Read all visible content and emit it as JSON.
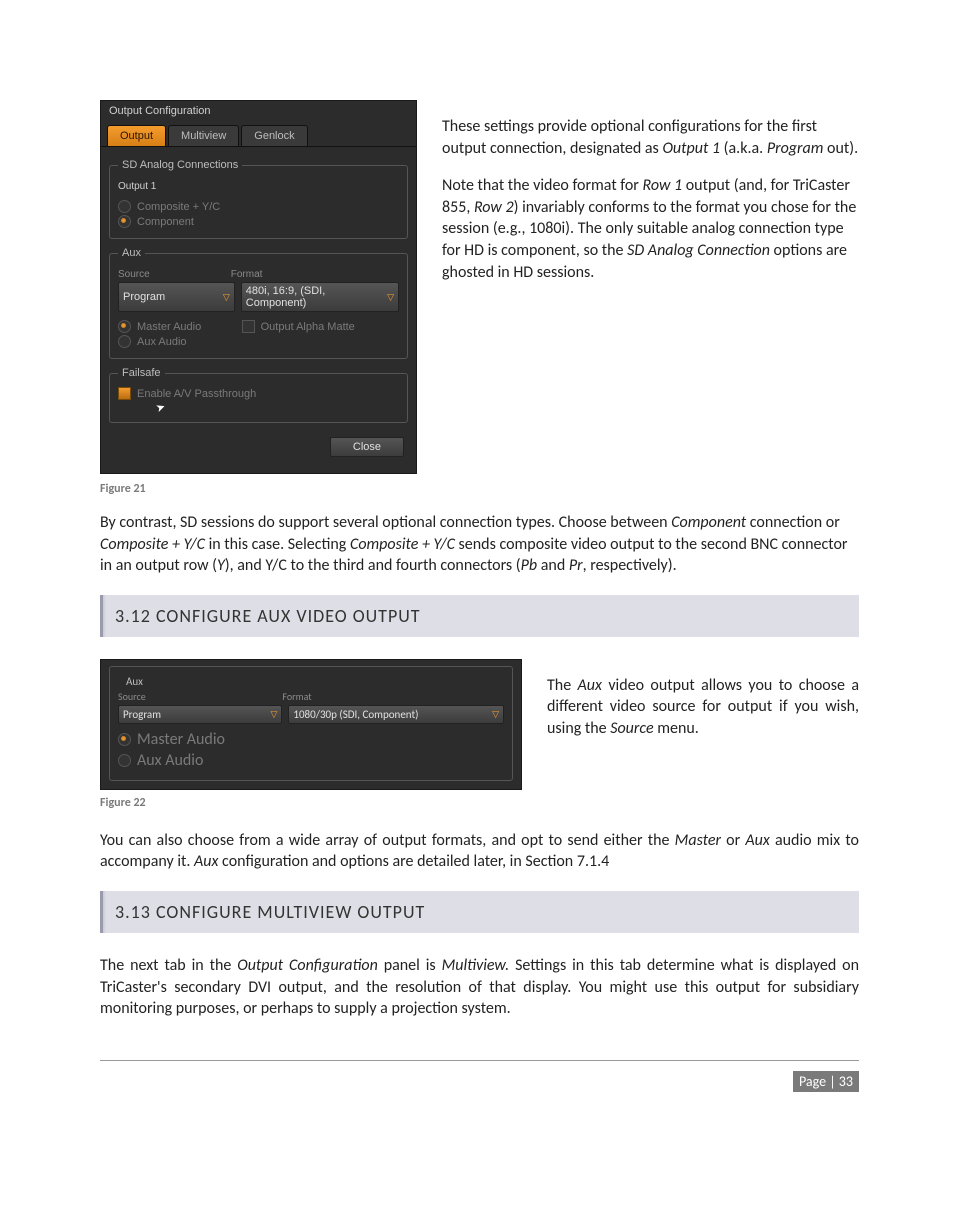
{
  "panel1": {
    "title": "Output Configuration",
    "tabs": [
      "Output",
      "Multiview",
      "Genlock"
    ],
    "active_tab": 0,
    "sd_group": {
      "legend": "SD Analog Connections",
      "output_label": "Output 1",
      "options": [
        "Composite + Y/C",
        "Component"
      ]
    },
    "aux_group": {
      "legend": "Aux",
      "source_label": "Source",
      "format_label": "Format",
      "source_value": "Program",
      "format_value": "480i, 16:9, (SDI, Component)",
      "radios": [
        "Master Audio",
        "Aux Audio"
      ],
      "alpha_label": "Output Alpha Matte"
    },
    "failsafe_group": {
      "legend": "Failsafe",
      "check_label": "Enable A/V Passthrough"
    },
    "close_label": "Close"
  },
  "para1a": "These settings provide optional configurations for the first output connection, designated as ",
  "para1b": "Output 1",
  "para1c": " (a.k.a. ",
  "para1d": "Program",
  "para1e": " out).",
  "para2a": "Note that the video format for ",
  "para2b": "Row 1",
  "para2c": " output (and, for TriCaster 855, ",
  "para2d": "Row 2",
  "para2e": ") invariably conforms to the format you chose for the session (e.g., 1080i). The only suitable analog connection type for HD is component, so the ",
  "para2f": "SD Analog Connection",
  "para2g": " options are ghosted in HD sessions.",
  "fig21": "Figure 21",
  "para3a": "By contrast, SD sessions do support several optional connection types.  Choose between ",
  "para3b": "Component",
  "para3c": " connection or ",
  "para3d": "Composite + Y/C",
  "para3e": " in this case. Selecting ",
  "para3f": "Composite + Y/C",
  "para3g": " sends composite video output to the second BNC connector in an output row (",
  "para3h": "Y",
  "para3i": "), and Y/C to the third and fourth connectors (",
  "para3j": "Pb",
  "para3k": " and ",
  "para3l": "Pr",
  "para3m": ", respectively).",
  "sec312": "3.12  CONFIGURE AUX VIDEO OUTPUT",
  "aux_panel": {
    "legend": "Aux",
    "source_label": "Source",
    "format_label": "Format",
    "source_value": "Program",
    "format_value": "1080/30p (SDI, Component)",
    "radios": [
      "Master Audio",
      "Aux Audio"
    ]
  },
  "para4a": "The ",
  "para4b": "Aux",
  "para4c": " video output allows you to choose a different video source for output if you wish, using the ",
  "para4d": "Source",
  "para4e": " menu.",
  "fig22": "Figure 22",
  "para5a": "You can also choose from a wide array of output formats, and opt to send either the ",
  "para5b": "Master",
  "para5c": " or ",
  "para5d": "Aux",
  "para5e": " audio mix to accompany it.  ",
  "para5f": "Aux",
  "para5g": " configuration and options are detailed later, in Section 7.1.4",
  "sec313": "3.13  CONFIGURE MULTIVIEW OUTPUT",
  "para6a": "The next tab in the ",
  "para6b": "Output Configuration",
  "para6c": " panel is ",
  "para6d": "Multiview.",
  "para6e": "  Settings in this tab determine what is displayed on TriCaster's secondary DVI output, and the resolution of that display.  You might use this output for subsidiary monitoring purposes, or perhaps to supply a projection system.",
  "page_label": "Page | 33"
}
